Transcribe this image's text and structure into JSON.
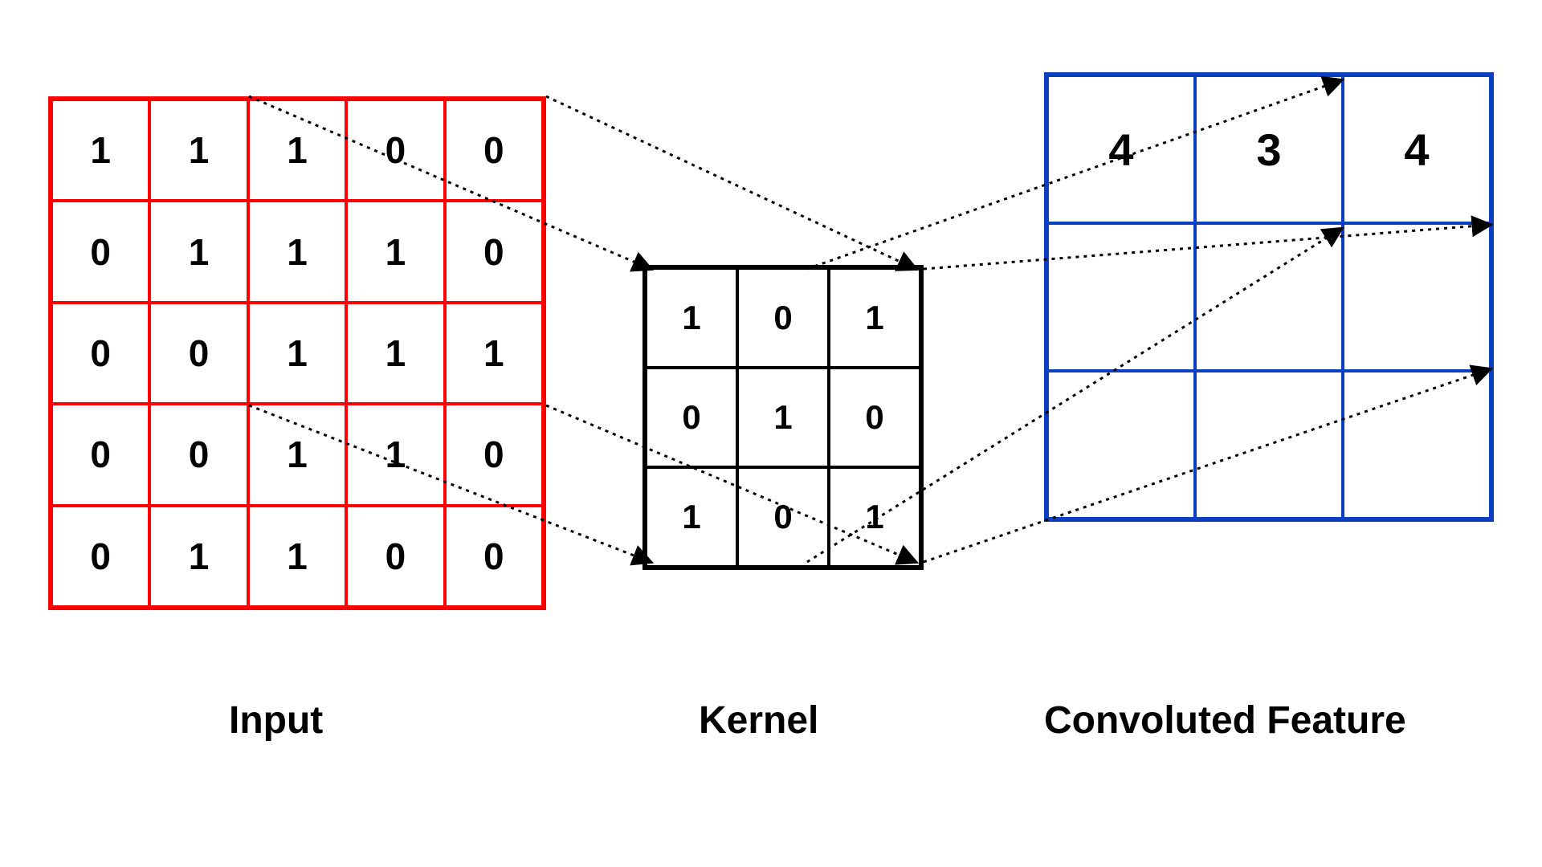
{
  "labels": {
    "input": "Input",
    "kernel": "Kernel",
    "output": "Convoluted Feature"
  },
  "input_matrix": [
    [
      1,
      1,
      1,
      0,
      0
    ],
    [
      0,
      1,
      1,
      1,
      0
    ],
    [
      0,
      0,
      1,
      1,
      1
    ],
    [
      0,
      0,
      1,
      1,
      0
    ],
    [
      0,
      1,
      1,
      0,
      0
    ]
  ],
  "kernel_matrix": [
    [
      1,
      0,
      1
    ],
    [
      0,
      1,
      0
    ],
    [
      1,
      0,
      1
    ]
  ],
  "output_matrix": [
    [
      4,
      3,
      4
    ],
    [
      "",
      "",
      ""
    ],
    [
      "",
      "",
      ""
    ]
  ],
  "chart_data": {
    "type": "table",
    "title": "Convolution illustration",
    "input": {
      "rows": 5,
      "cols": 5,
      "values": [
        [
          1,
          1,
          1,
          0,
          0
        ],
        [
          0,
          1,
          1,
          1,
          0
        ],
        [
          0,
          0,
          1,
          1,
          1
        ],
        [
          0,
          0,
          1,
          1,
          0
        ],
        [
          0,
          1,
          1,
          0,
          0
        ]
      ],
      "border_color": "#ff0000"
    },
    "kernel": {
      "rows": 3,
      "cols": 3,
      "values": [
        [
          1,
          0,
          1
        ],
        [
          0,
          1,
          0
        ],
        [
          1,
          0,
          1
        ]
      ],
      "border_color": "#000000"
    },
    "output": {
      "rows": 3,
      "cols": 3,
      "values": [
        [
          4,
          3,
          4
        ],
        [
          null,
          null,
          null
        ],
        [
          null,
          null,
          null
        ]
      ],
      "border_color": "#0b3fbf"
    }
  }
}
